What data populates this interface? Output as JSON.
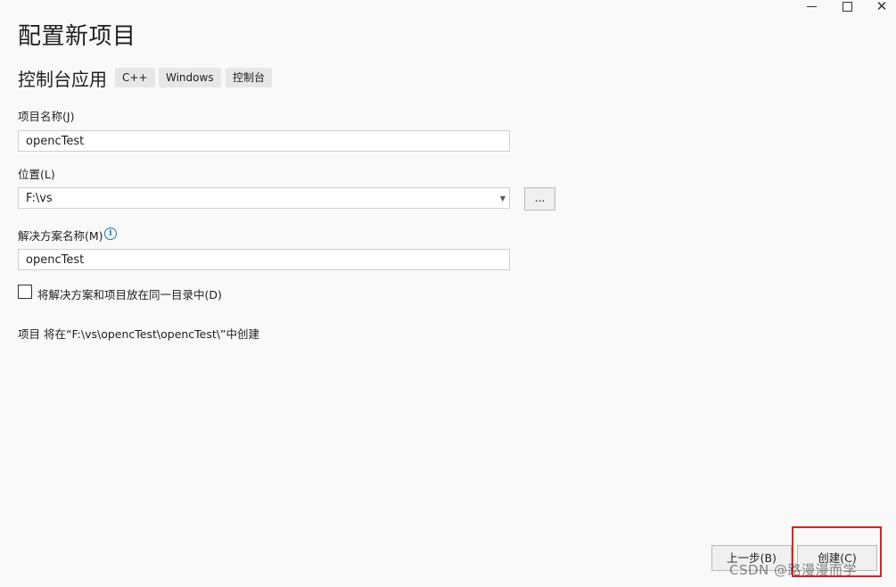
{
  "window": {
    "title": "配置新项目"
  },
  "header": {
    "subtitle": "控制台应用",
    "tags": [
      "C++",
      "Windows",
      "控制台"
    ]
  },
  "form": {
    "name_label": "项目名称(J)",
    "name_value": "opencTest",
    "location_label": "位置(L)",
    "location_value": "F:\\vs",
    "browse_label": "...",
    "solution_label": "解决方案名称(M)",
    "solution_value": "opencTest",
    "same_dir_label": "将解决方案和项目放在同一目录中(D)",
    "same_dir_checked": false,
    "info": "项目 将在“F:\\vs\\opencTest\\opencTest\\”中创建"
  },
  "footer": {
    "back_label": "上一步(B)",
    "create_label": "创建(C)"
  },
  "watermark": "CSDN @路漫漫而学",
  "colors": {
    "background": "#f9f9f9",
    "highlight": "#e02020",
    "info_icon": "#1a73c8"
  }
}
